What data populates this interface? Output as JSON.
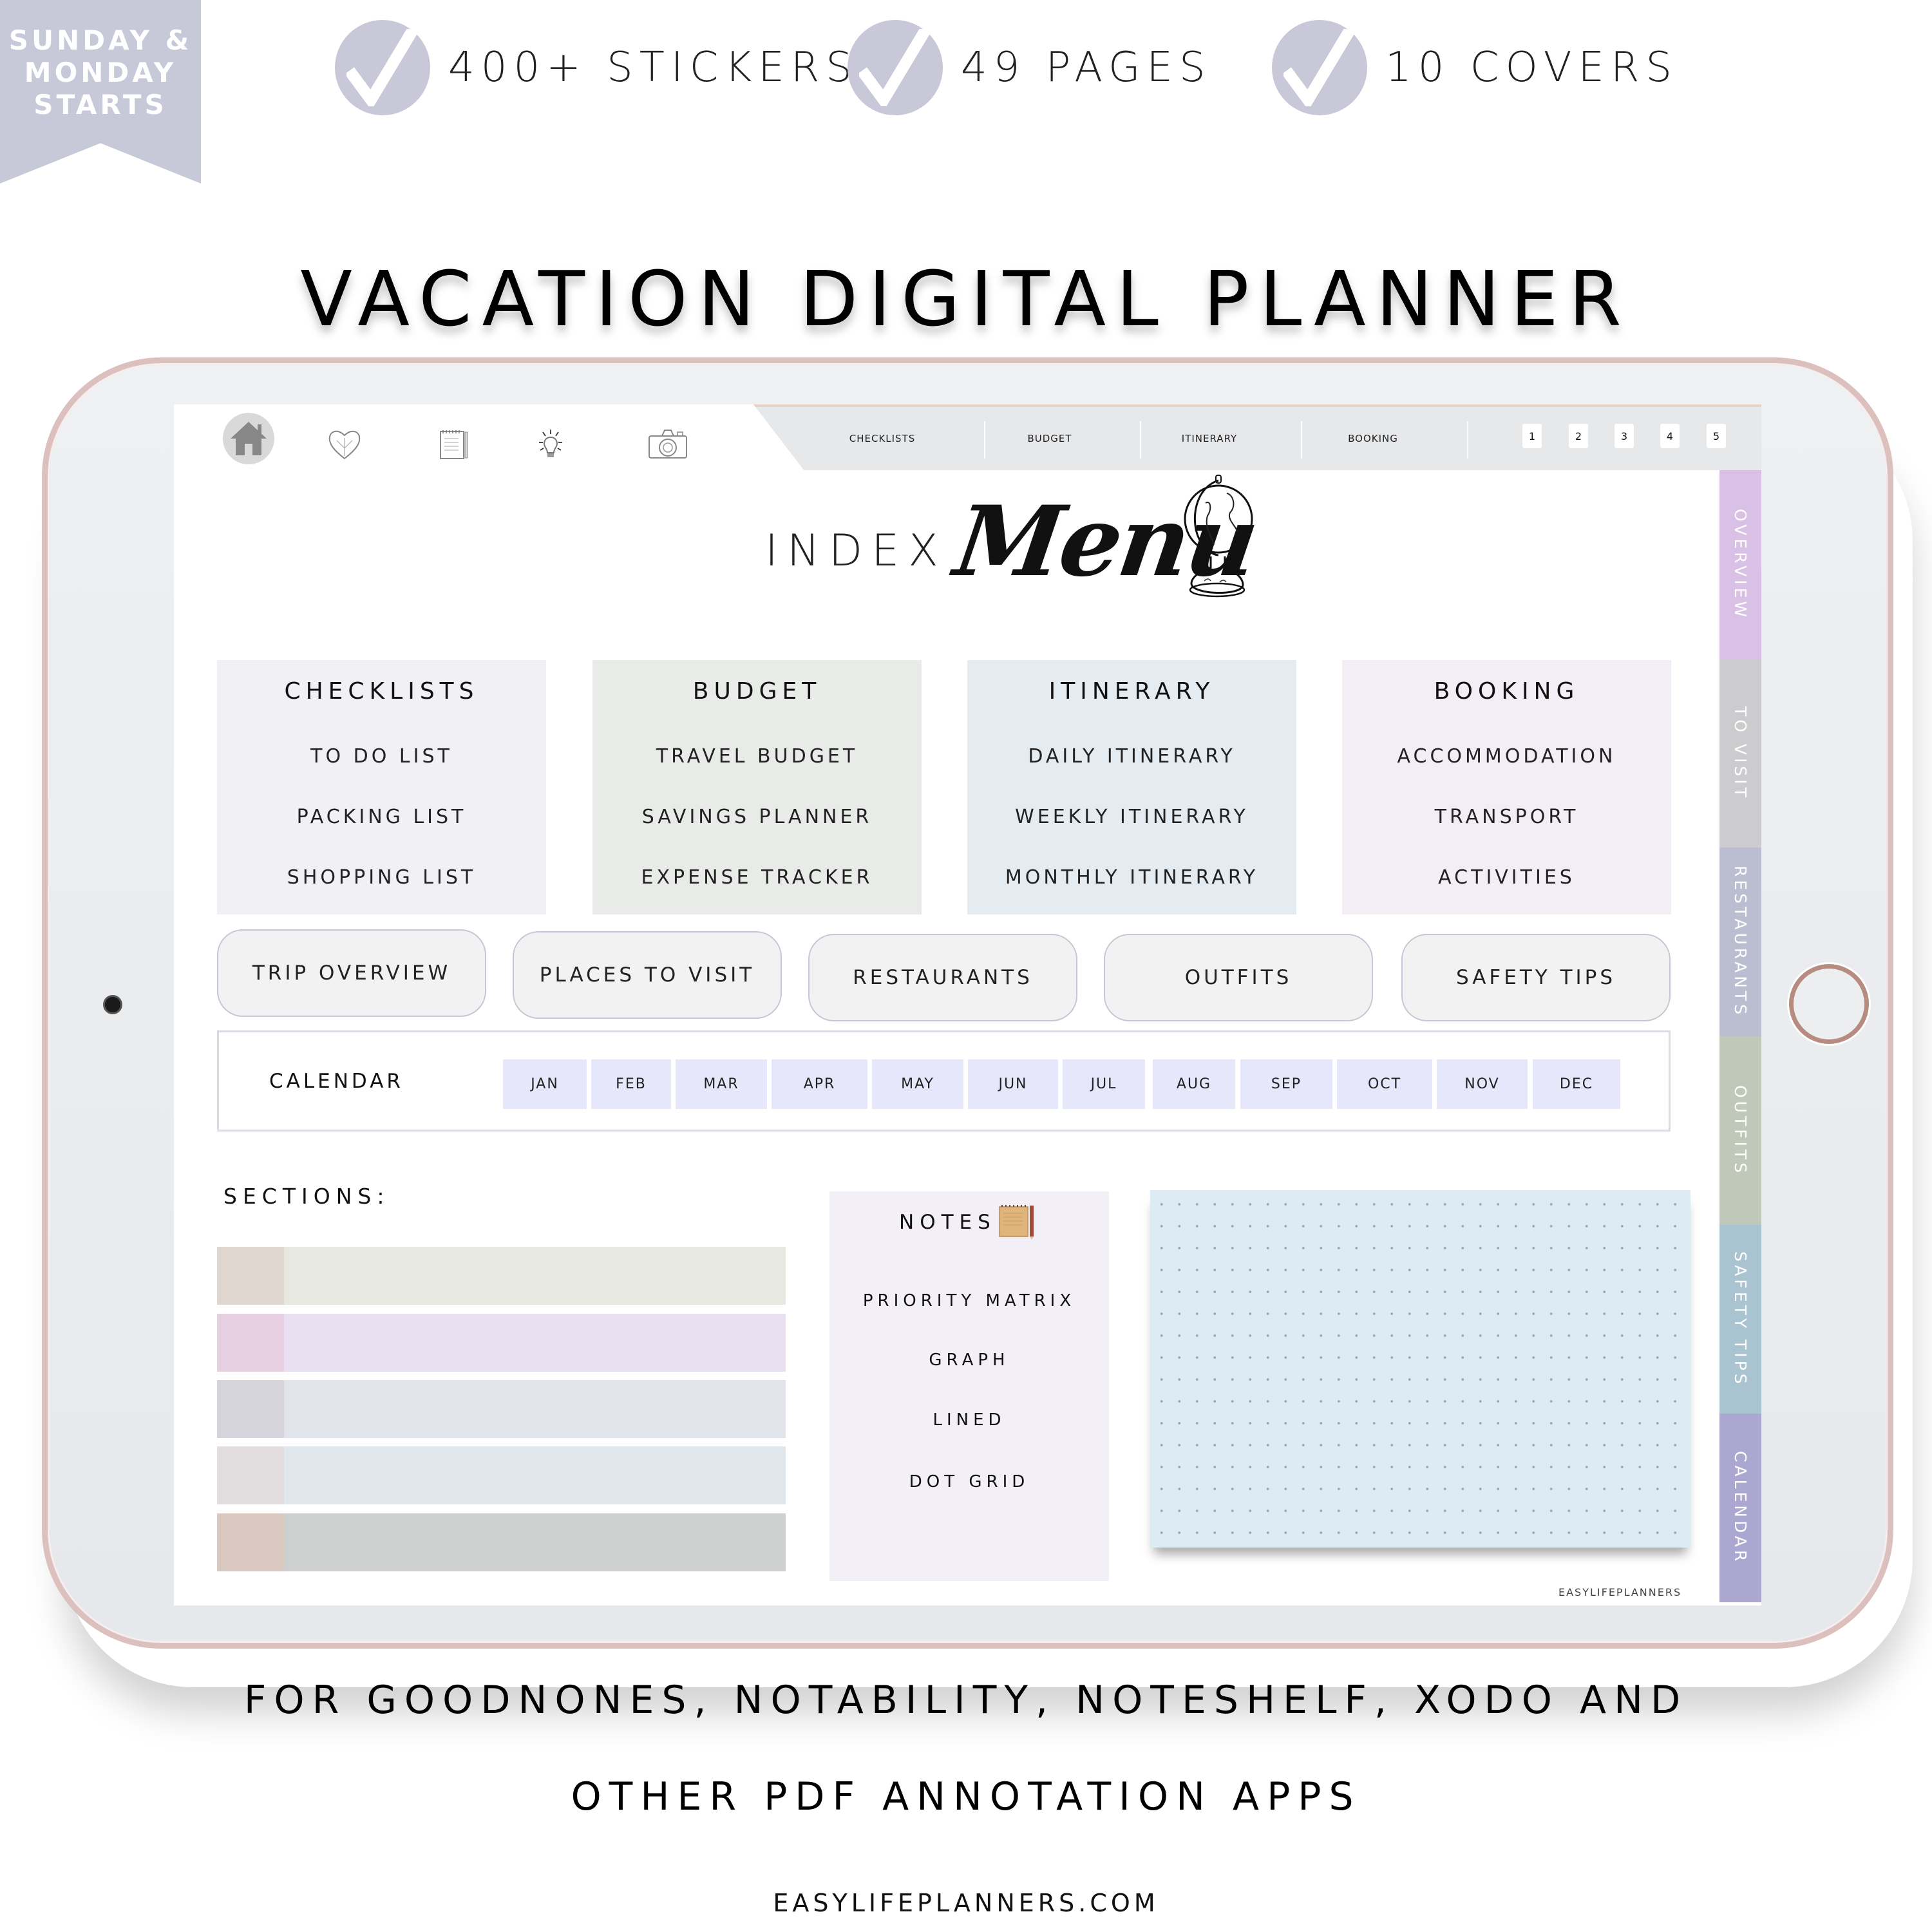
{
  "ribbon": {
    "lines": [
      "SUNDAY &",
      "MONDAY",
      "STARTS"
    ],
    "color": "#c7c8d8"
  },
  "features": [
    {
      "label": "400+ STICKERS",
      "icon": "check-icon"
    },
    {
      "label": "49 PAGES",
      "icon": "check-icon"
    },
    {
      "label": "10 COVERS",
      "icon": "check-icon"
    }
  ],
  "title": "VACATION DIGITAL PLANNER",
  "planner": {
    "nav_icons": [
      "home-icon",
      "heart-icon",
      "notepad-icon",
      "lightbulb-icon",
      "camera-icon"
    ],
    "nav_links": [
      "CHECKLISTS",
      "BUDGET",
      "ITINERARY",
      "BOOKING"
    ],
    "page_numbers": [
      "1",
      "2",
      "3",
      "4",
      "5"
    ],
    "header": {
      "index": "INDEX",
      "menu": "Menu",
      "icon": "globe-icon"
    },
    "cards": [
      {
        "title": "CHECKLISTS",
        "items": [
          "TO DO LIST",
          "PACKING LIST",
          "SHOPPING LIST"
        ],
        "color": "#f0f0f5"
      },
      {
        "title": "BUDGET",
        "items": [
          "TRAVEL BUDGET",
          "SAVINGS PLANNER",
          "EXPENSE TRACKER"
        ],
        "color": "#e9ebe9"
      },
      {
        "title": "ITINERARY",
        "items": [
          "DAILY ITINERARY",
          "WEEKLY ITINERARY",
          "MONTHLY ITINERARY"
        ],
        "color": "#e4ecf2"
      },
      {
        "title": "BOOKING",
        "items": [
          "ACCOMMODATION",
          "TRANSPORT",
          "ACTIVITIES"
        ],
        "color": "#f3edf6"
      }
    ],
    "pills": [
      "TRIP OVERVIEW",
      "PLACES TO VISIT",
      "RESTAURANTS",
      "OUTFITS",
      "SAFETY TIPS"
    ],
    "calendar": {
      "label": "CALENDAR",
      "months": [
        "JAN",
        "FEB",
        "MAR",
        "APR",
        "MAY",
        "JUN",
        "JUL",
        "AUG",
        "SEP",
        "OCT",
        "NOV",
        "DEC"
      ]
    },
    "sections": {
      "label": "SECTIONS:",
      "bars": [
        {
          "swatch": "#e0d8d0",
          "fill": "#e7e8e0"
        },
        {
          "swatch": "#e6d0e2",
          "fill": "#e9dff0"
        },
        {
          "swatch": "#d5d4dd",
          "fill": "#e1e4ea"
        },
        {
          "swatch": "#e1dcde",
          "fill": "#e0e8ee"
        },
        {
          "swatch": "#d9c9c1",
          "fill": "#cdd0ce"
        }
      ]
    },
    "notes": {
      "title": "NOTES",
      "icon": "notepad-pencil-icon",
      "items": [
        "PRIORITY MATRIX",
        "GRAPH",
        "LINED",
        "DOT GRID"
      ]
    },
    "watermark": "EASYLIFEPLANNERS",
    "side_tabs": [
      {
        "label": "OVERVIEW",
        "color": "#d9c0e5"
      },
      {
        "label": "TO VISIT",
        "color": "#ccccce"
      },
      {
        "label": "RESTAURANTS",
        "color": "#bbbdd0"
      },
      {
        "label": "OUTFITS",
        "color": "#c0c9b9"
      },
      {
        "label": "SAFETY TIPS",
        "color": "#aac3d1"
      },
      {
        "label": "CALENDAR",
        "color": "#aca7d1"
      }
    ]
  },
  "footer": {
    "line1": "FOR GOODNONES, NOTABILITY, NOTESHELF, XODO AND",
    "line2": "OTHER PDF ANNOTATION APPS",
    "site": "EASYLIFEPLANNERS.COM"
  }
}
